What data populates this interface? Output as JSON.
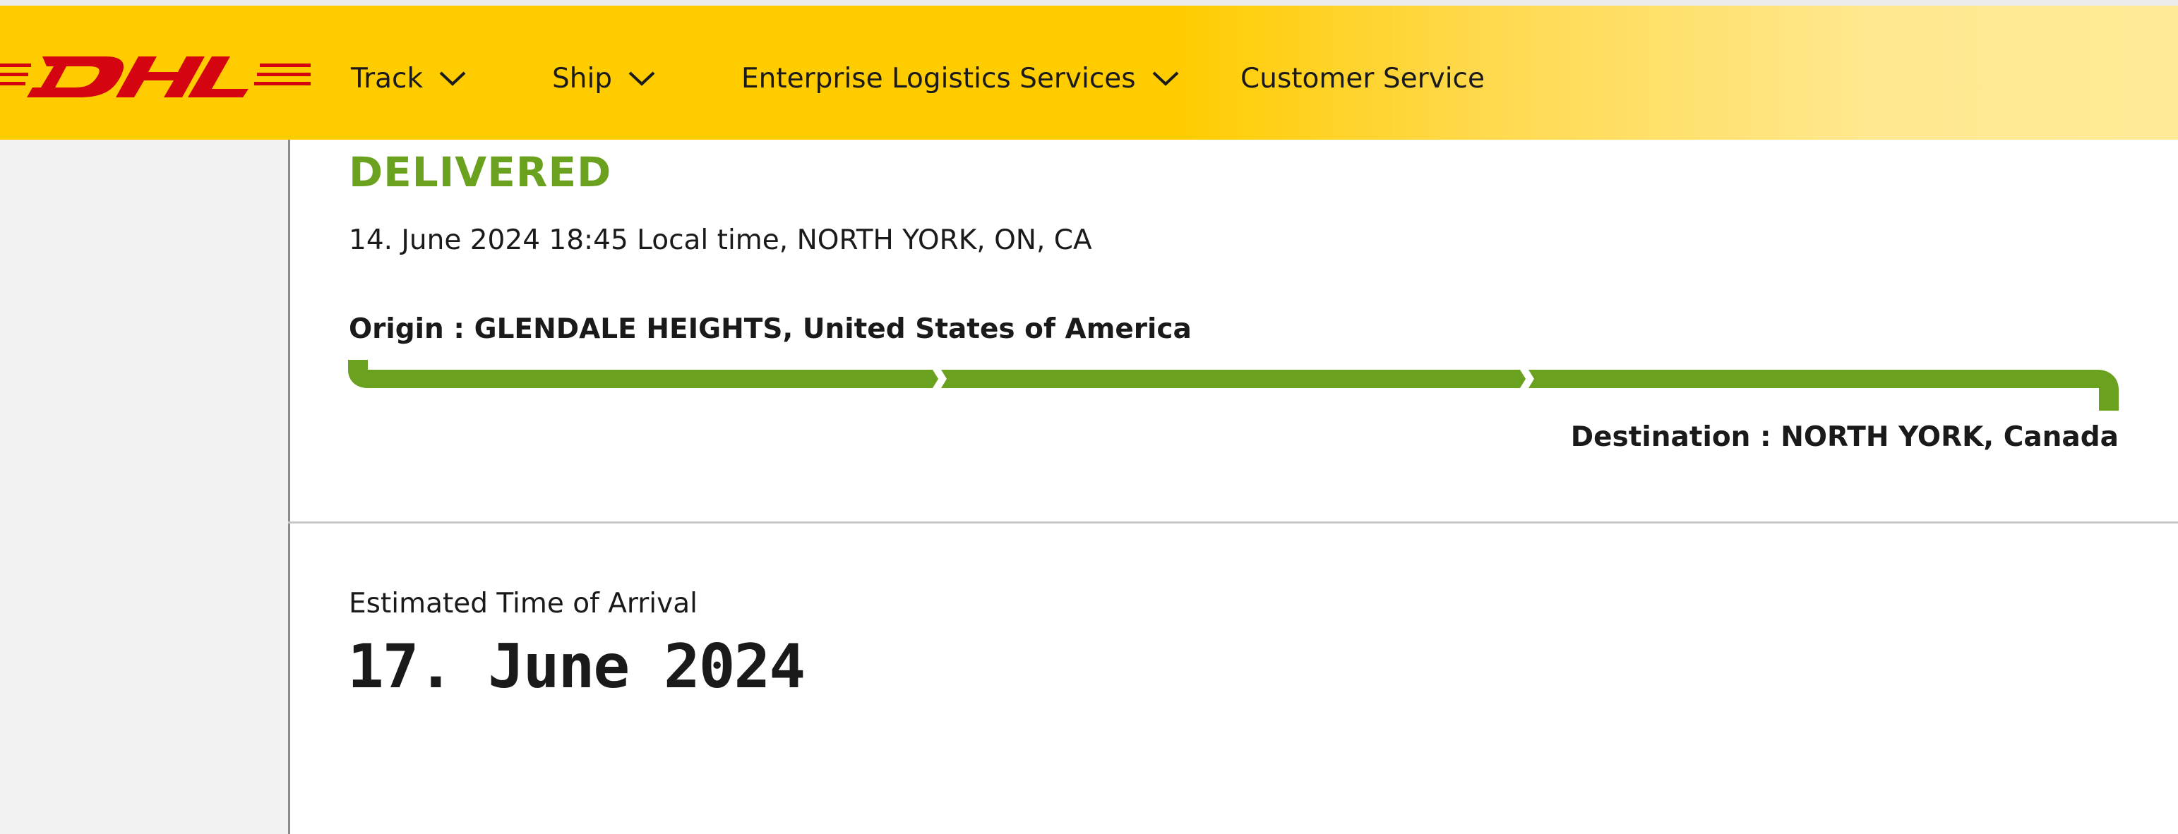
{
  "header": {
    "logo_text": "DHL",
    "nav": {
      "track": "Track",
      "ship": "Ship",
      "enterprise": "Enterprise Logistics Services",
      "customer_service": "Customer Service"
    }
  },
  "shipment": {
    "status": "DELIVERED",
    "timestamp": "14. June 2024 18:45 Local time, NORTH YORK, ON, CA",
    "origin_label": "Origin : ",
    "origin_value": "GLENDALE HEIGHTS, United States of America",
    "destination_label": "Destination : ",
    "destination_value": "NORTH YORK, Canada",
    "progress_fraction": 1.0,
    "progress_segments": 3
  },
  "eta": {
    "label": "Estimated Time of Arrival",
    "date": "17. June 2024"
  },
  "colors": {
    "brand_yellow": "#ffcc00",
    "brand_red": "#d40511",
    "status_green": "#6aa11e"
  },
  "icons": {
    "nav_dropdown": "chevron-down-icon"
  }
}
